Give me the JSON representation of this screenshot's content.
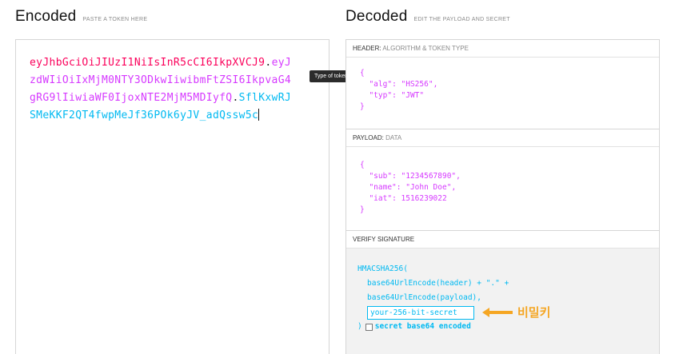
{
  "encoded": {
    "title": "Encoded",
    "subtitle": "PASTE A TOKEN HERE",
    "token_header": "eyJhbGciOiJIUzI1NiIsInR5cCI6IkpXVCJ9",
    "token_payload": "eyJzdWIiOiIxMjM0NTY3ODkwIiwibmFtZSI6IkpvaG4gRG9lIiwiaWF0IjoxNTE2MjM5MDIyfQ",
    "token_signature": "SflKxwRJSMeKKF2QT4fwpMeJf36POk6yJV_adQssw5c",
    "dot": "."
  },
  "tooltip": "Type of token",
  "decoded": {
    "title": "Decoded",
    "subtitle": "EDIT THE PAYLOAD AND SECRET",
    "header": {
      "label": "HEADER:",
      "sub": "ALGORITHM & TOKEN TYPE",
      "open": "{",
      "close": "}",
      "alg_key": "\"alg\"",
      "alg_val": "\"HS256\"",
      "typ_key": "\"typ\"",
      "typ_val": "\"JWT\""
    },
    "payload": {
      "label": "PAYLOAD:",
      "sub": "DATA",
      "open": "{",
      "close": "}",
      "sub_key": "\"sub\"",
      "sub_val": "\"1234567890\"",
      "name_key": "\"name\"",
      "name_val": "\"John Doe\"",
      "iat_key": "\"iat\"",
      "iat_val": "1516239022"
    },
    "verify": {
      "label": "VERIFY SIGNATURE",
      "fn": "HMACSHA256(",
      "line1": "base64UrlEncode(header) + \".\" +",
      "line2": "base64UrlEncode(payload),",
      "secret_value": "your-256-bit-secret",
      "close": ")",
      "checkbox_label": "secret base64 encoded",
      "annotation": "비밀키",
      "annotation_color": "#f5a623"
    }
  },
  "colors": {
    "header": "#fb015b",
    "payload": "#d63aff",
    "signature": "#00b9f1"
  }
}
